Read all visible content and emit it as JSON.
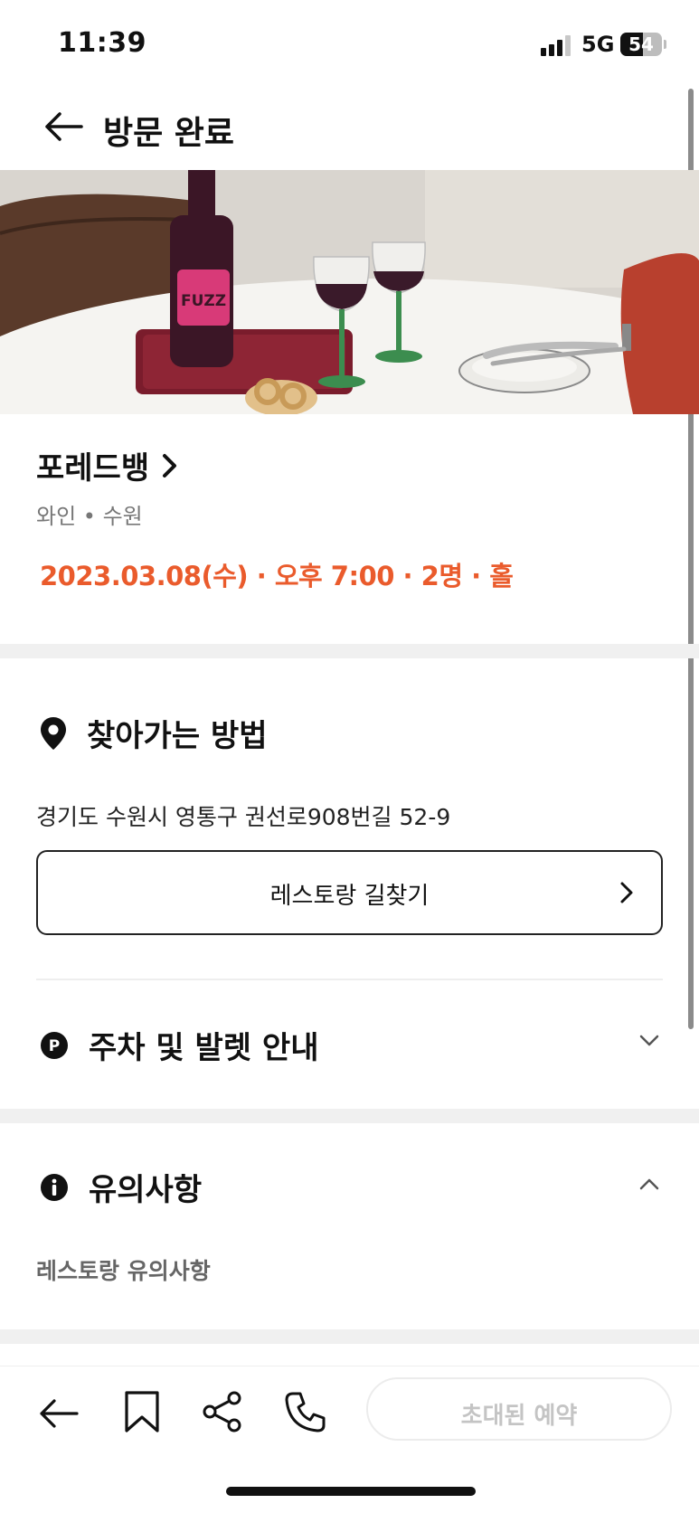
{
  "status_bar": {
    "time": "11:39",
    "network": "5G",
    "battery": "54",
    "battery_level": 0.54
  },
  "header": {
    "back_icon": "arrow-left-icon",
    "title": "방문 완료"
  },
  "hero": {
    "bottle_label": "FUZZ"
  },
  "restaurant": {
    "name": "포레드뱅",
    "category": "와인 • 수원",
    "booking": "2023.03.08(수) · 오후 7:00 · 2명 · 홀"
  },
  "directions": {
    "icon": "location-pin-icon",
    "title": "찾아가는 방법",
    "address": "경기도 수원시 영통구 권선로908번길 52-9",
    "route_button": "레스토랑 길찾기"
  },
  "parking": {
    "icon": "parking-icon",
    "title": "주차 및 발렛 안내"
  },
  "notice": {
    "icon": "info-icon",
    "title": "유의사항",
    "subtitle": "레스토랑 유의사항"
  },
  "bottom_bar": {
    "icons": [
      "arrow-left-icon",
      "bookmark-icon",
      "share-icon",
      "phone-icon"
    ],
    "invite_button": "초대된 예약"
  },
  "colors": {
    "accent": "#ea5b2c",
    "text": "#111111",
    "separator": "#f0f0f0"
  }
}
